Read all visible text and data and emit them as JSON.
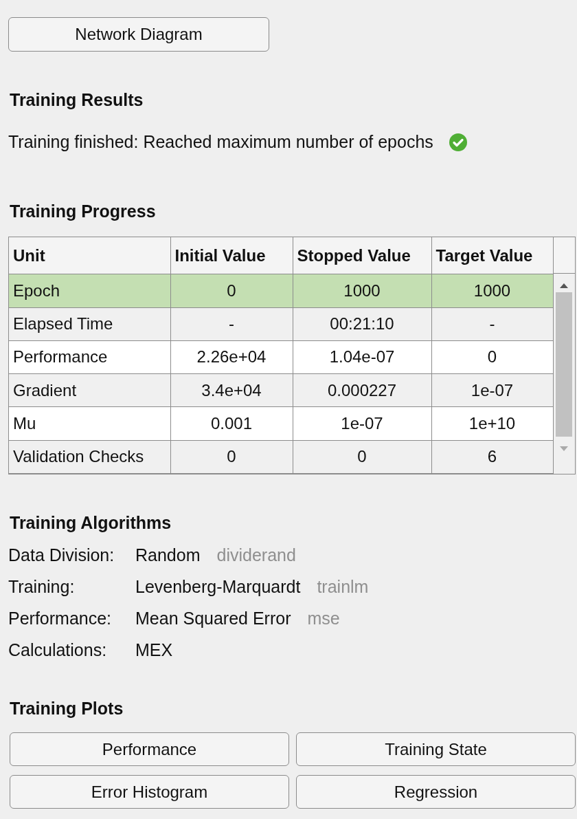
{
  "network_button": "Network Diagram",
  "training_results": {
    "heading": "Training Results",
    "status": "Training finished: Reached maximum number of epochs",
    "success": true
  },
  "training_progress": {
    "heading": "Training Progress",
    "columns": [
      "Unit",
      "Initial Value",
      "Stopped Value",
      "Target Value"
    ],
    "rows": [
      {
        "cells": [
          "Epoch",
          "0",
          "1000",
          "1000"
        ],
        "selected": true
      },
      {
        "cells": [
          "Elapsed Time",
          "-",
          "00:21:10",
          "-"
        ],
        "selected": false
      },
      {
        "cells": [
          "Performance",
          "2.26e+04",
          "1.04e-07",
          "0"
        ],
        "selected": false
      },
      {
        "cells": [
          "Gradient",
          "3.4e+04",
          "0.000227",
          "1e-07"
        ],
        "selected": false
      },
      {
        "cells": [
          "Mu",
          "0.001",
          "1e-07",
          "1e+10"
        ],
        "selected": false
      },
      {
        "cells": [
          "Validation Checks",
          "0",
          "0",
          "6"
        ],
        "selected": false
      }
    ]
  },
  "training_algorithms": {
    "heading": "Training Algorithms",
    "items": [
      {
        "label": "Data Division:",
        "value": "Random",
        "function": "dividerand"
      },
      {
        "label": "Training:",
        "value": "Levenberg-Marquardt",
        "function": "trainlm"
      },
      {
        "label": "Performance:",
        "value": "Mean Squared Error",
        "function": "mse"
      },
      {
        "label": "Calculations:",
        "value": "MEX"
      }
    ]
  },
  "training_plots": {
    "heading": "Training Plots",
    "buttons": [
      "Performance",
      "Training State",
      "Error Histogram",
      "Regression"
    ]
  }
}
